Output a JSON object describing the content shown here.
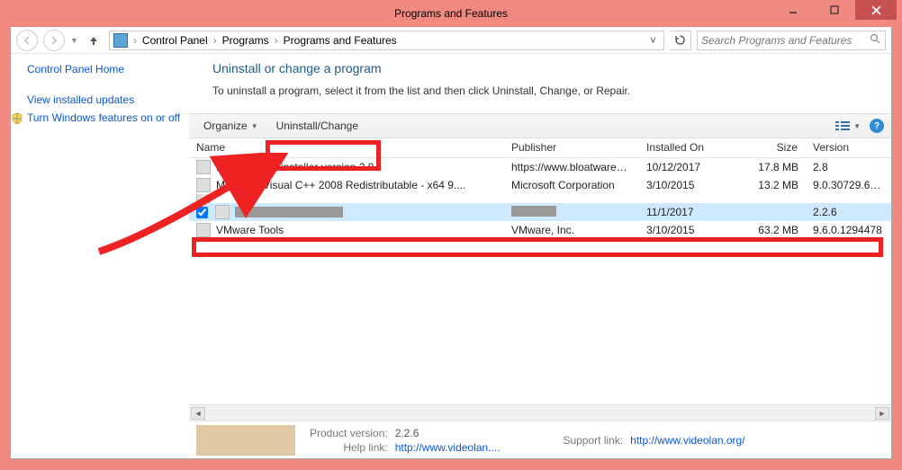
{
  "window": {
    "title": "Programs and Features"
  },
  "breadcrumbs": {
    "items": [
      "Control Panel",
      "Programs",
      "Programs and Features"
    ]
  },
  "search": {
    "placeholder": "Search Programs and Features"
  },
  "leftnav": {
    "home": "Control Panel Home",
    "links": [
      {
        "label": "View installed updates"
      },
      {
        "label": "Turn Windows features on or off",
        "shield": true
      }
    ]
  },
  "page": {
    "title": "Uninstall or change a program",
    "description": "To uninstall a program, select it from the list and then click Uninstall, Change, or Repair."
  },
  "toolbar": {
    "organize": "Organize",
    "uninstall_change": "Uninstall/Change"
  },
  "columns": {
    "name": "Name",
    "publisher": "Publisher",
    "installed": "Installed On",
    "size": "Size",
    "version": "Version"
  },
  "rows": [
    {
      "name": "Bloatware Uninstaller version 2.8",
      "publisher": "https://www.bloatwareuninstall...",
      "installed": "10/12/2017",
      "size": "17.8 MB",
      "version": "2.8"
    },
    {
      "name": "Microsoft Visual C++ 2008 Redistributable - x64 9....",
      "publisher": "Microsoft Corporation",
      "installed": "3/10/2015",
      "size": "13.2 MB",
      "version": "9.0.30729.6161"
    },
    {
      "name": "",
      "publisher": "",
      "installed": "",
      "size": "",
      "version": "",
      "truncated_top": true
    },
    {
      "name": "",
      "publisher": "",
      "installed": "11/1/2017",
      "size": "",
      "version": "2.2.6",
      "selected": true,
      "redacted": true
    },
    {
      "name": "VMware Tools",
      "publisher": "VMware, Inc.",
      "installed": "3/10/2015",
      "size": "63.2 MB",
      "version": "9.6.0.1294478"
    }
  ],
  "details": {
    "product_version_label": "Product version:",
    "product_version": "2.2.6",
    "help_link_label": "Help link:",
    "help_link": "http://www.videolan....",
    "support_link_label": "Support link:",
    "support_link": "http://www.videolan.org/"
  }
}
